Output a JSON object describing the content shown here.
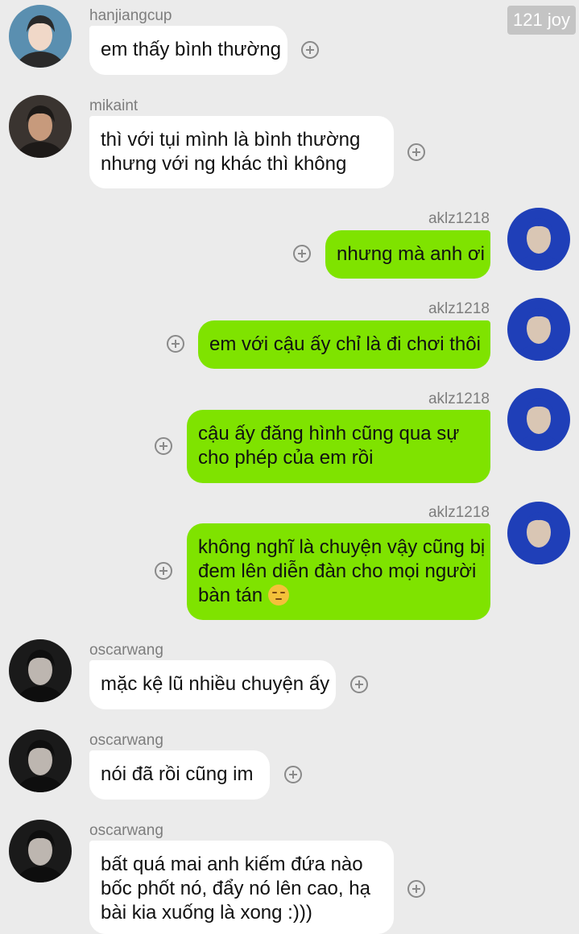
{
  "badge": {
    "label": "121 joy"
  },
  "messages": [
    {
      "user": "hanjiangcup",
      "side": "left",
      "avatar_icon": "user-avatar-icon",
      "lines": [
        "em thấy bình thường"
      ]
    },
    {
      "user": "mikaint",
      "side": "left",
      "avatar_icon": "user-avatar-icon",
      "lines": [
        "thì với tụi mình là bình thường",
        "nhưng với ng khác thì không"
      ]
    },
    {
      "user": "aklz1218",
      "side": "right",
      "avatar_icon": "user-avatar-icon",
      "lines": [
        "nhưng mà anh ơi"
      ]
    },
    {
      "user": "aklz1218",
      "side": "right",
      "avatar_icon": "user-avatar-icon",
      "lines": [
        "em với cậu ấy chỉ là đi chơi thôi"
      ]
    },
    {
      "user": "aklz1218",
      "side": "right",
      "avatar_icon": "user-avatar-icon",
      "lines": [
        "cậu ấy đăng hình cũng qua sự",
        "cho phép của em rồi"
      ]
    },
    {
      "user": "aklz1218",
      "side": "right",
      "avatar_icon": "user-avatar-icon",
      "lines": [
        "không nghĩ là chuyện vậy cũng bị",
        "đem lên diễn đàn cho mọi người",
        "bàn tán"
      ],
      "emoji": "pensive-face-emoji"
    },
    {
      "user": "oscarwang",
      "side": "left",
      "avatar_icon": "user-avatar-icon",
      "lines": [
        "mặc kệ lũ nhiều chuyện ấy"
      ]
    },
    {
      "user": "oscarwang",
      "side": "left",
      "avatar_icon": "user-avatar-icon",
      "lines": [
        "nói đã rồi cũng im"
      ]
    },
    {
      "user": "oscarwang",
      "side": "left",
      "avatar_icon": "user-avatar-icon",
      "lines": [
        "bất quá mai anh kiếm đứa nào",
        "bốc phốt nó, đẩy nó lên cao, hạ",
        "bài kia xuống là xong :)))"
      ]
    }
  ],
  "colors": {
    "background": "#ebebeb",
    "incoming_bubble": "#ffffff",
    "outgoing_bubble": "#7fe300",
    "username": "#7d7d7d",
    "badge": "#c4c4c4"
  }
}
